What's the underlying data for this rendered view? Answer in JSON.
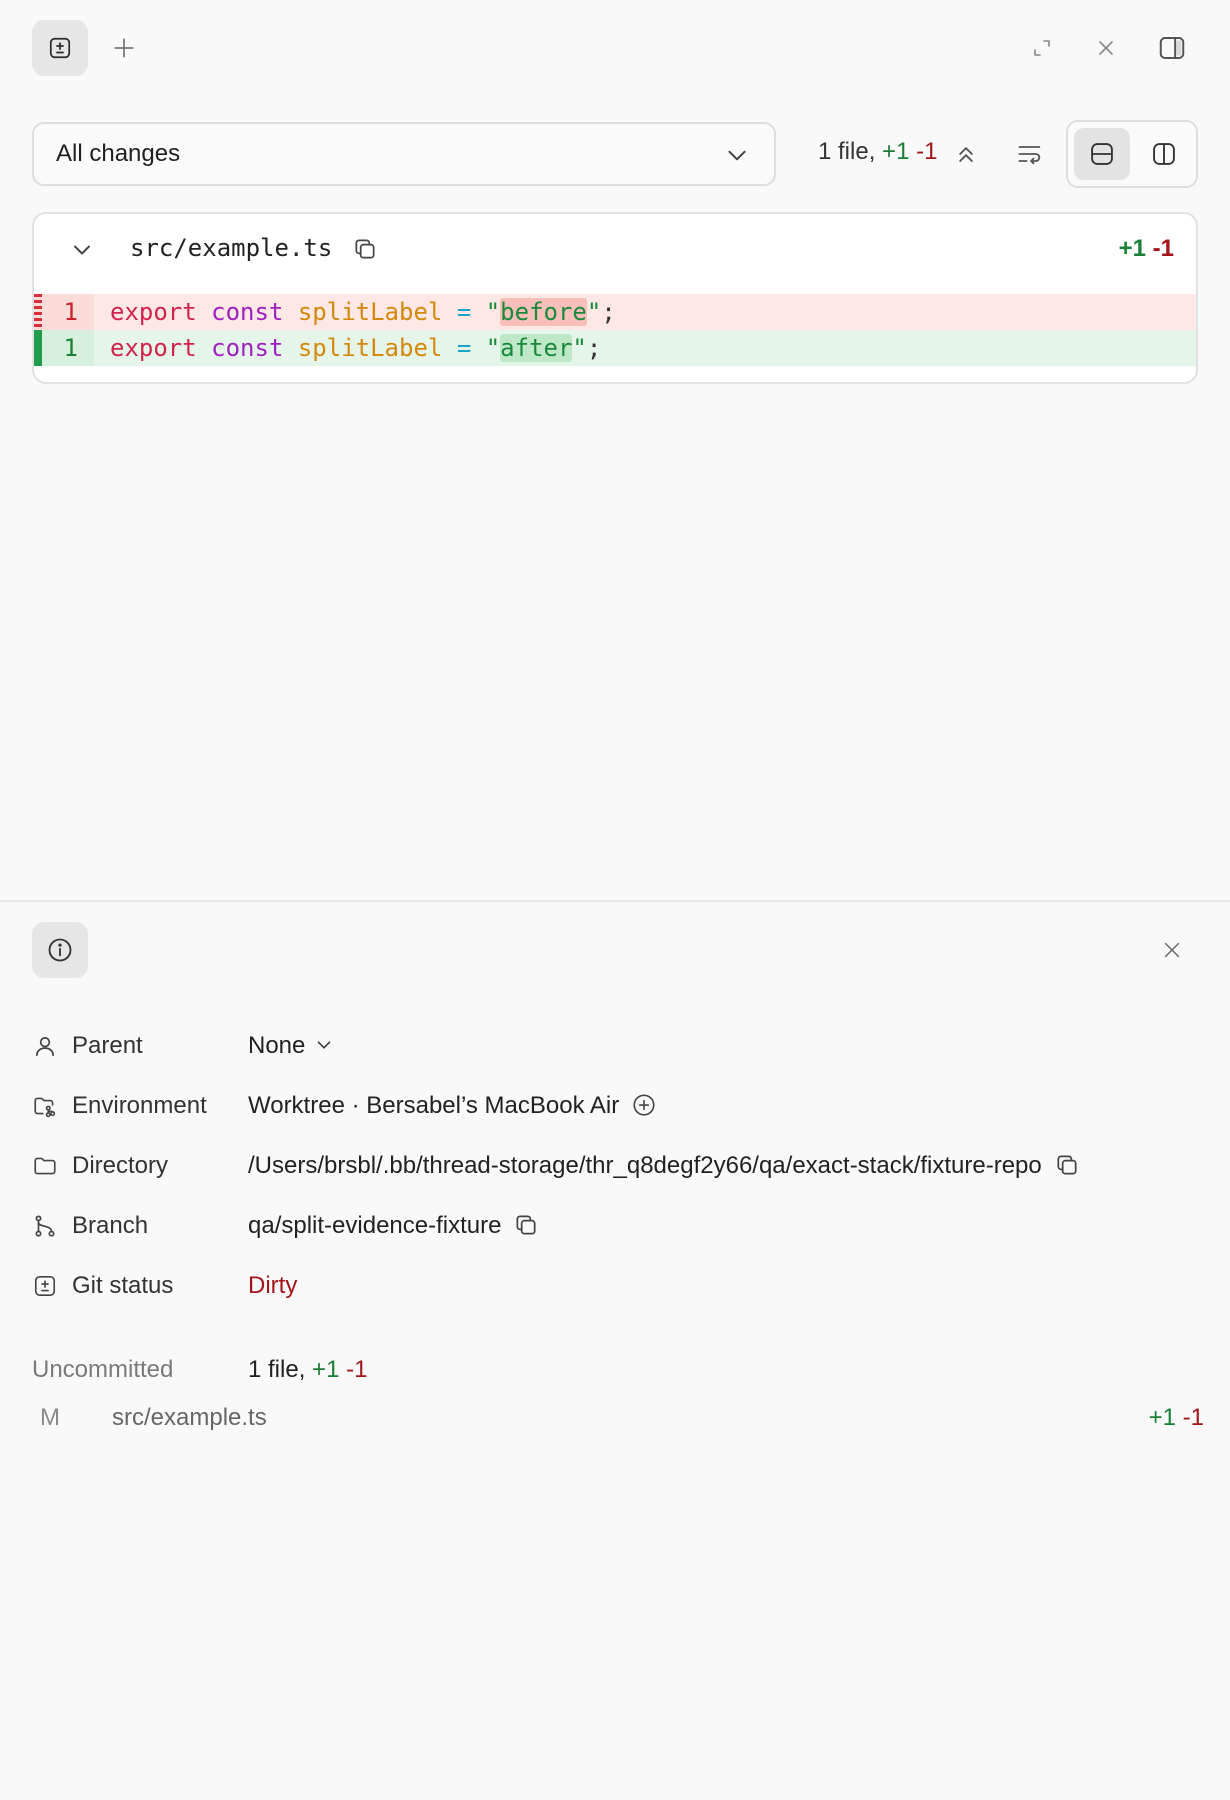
{
  "colors": {
    "addition": "#1a7f37",
    "deletion": "#a3151b",
    "add_bg": "#e6f5ea",
    "del_bg": "#fde8e6"
  },
  "topbar": {
    "diff_tab_icon": "plus-minus-box-icon",
    "new_tab_icon": "plus-icon",
    "expand_icon": "expand-icon",
    "close_icon": "close-icon",
    "sidebar_icon": "sidebar-panel-icon"
  },
  "toolbar": {
    "scope_selected": "All changes",
    "summary_files": "1 file,",
    "summary_added": "+1",
    "summary_removed": "-1",
    "collapse_all_icon": "chevrons-up-icon",
    "wrap_icon": "wrap-lines-icon",
    "unified_view_icon": "unified-view-icon",
    "split_view_icon": "split-view-icon",
    "active_view": "unified"
  },
  "diff": {
    "file_name": "src/example.ts",
    "added": "+1",
    "removed": "-1",
    "lines": [
      {
        "type": "del",
        "number": "1",
        "kw1": "export",
        "kw2": "const",
        "ident": "splitLabel",
        "op": "=",
        "q1": "\"",
        "value": "before",
        "q2": "\"",
        "end": ";"
      },
      {
        "type": "add",
        "number": "1",
        "kw1": "export",
        "kw2": "const",
        "ident": "splitLabel",
        "op": "=",
        "q1": "\"",
        "value": "after",
        "q2": "\"",
        "end": ";"
      }
    ]
  },
  "details": {
    "info_icon": "info-icon",
    "rows": [
      {
        "icon": "person-icon",
        "label": "Parent",
        "value": "None"
      },
      {
        "icon": "environment-icon",
        "label": "Environment",
        "value": "Worktree · Bersabel’s MacBook Air"
      },
      {
        "icon": "folder-icon",
        "label": "Directory",
        "value": "/Users/brsbl/.bb/thread-storage/thr_q8degf2y66/qa/exact-stack/fixture-repo"
      },
      {
        "icon": "branch-icon",
        "label": "Branch",
        "value": "qa/split-evidence-fixture"
      },
      {
        "icon": "plus-minus-box-icon",
        "label": "Git status",
        "value": "Dirty"
      }
    ],
    "uncommitted_label": "Uncommitted",
    "uncommitted_files": "1 file,",
    "uncommitted_added": "+1",
    "uncommitted_removed": "-1",
    "files": [
      {
        "status": "M",
        "name": "src/example.ts",
        "added": "+1",
        "removed": "-1"
      }
    ]
  }
}
